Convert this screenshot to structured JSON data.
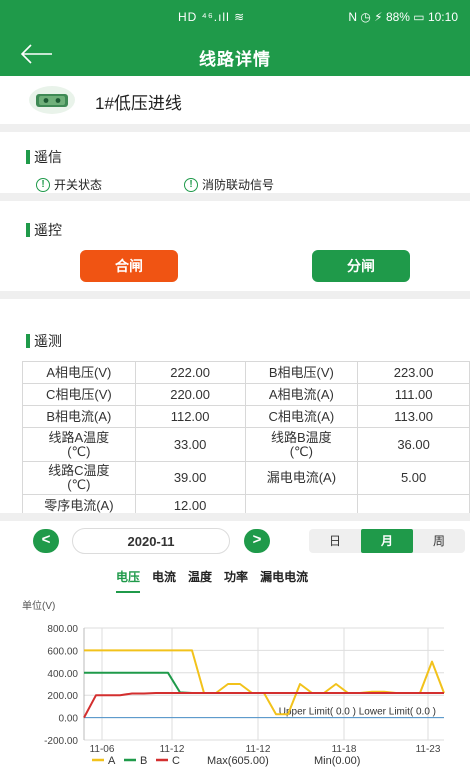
{
  "status": {
    "signal": "HD ⁴⁶.ıll ≋",
    "right": "N ◷ ⚡ 88% ▭ 10:10"
  },
  "appbar": {
    "title": "线路详情"
  },
  "device": {
    "name": "1#低压进线"
  },
  "remote_signal": {
    "title": "遥信",
    "items": [
      "开关状态",
      "消防联动信号"
    ]
  },
  "remote_control": {
    "title": "遥控",
    "close_label": "合闸",
    "open_label": "分闸"
  },
  "telemetry": {
    "title": "遥测",
    "rows": [
      [
        "A相电压(V)",
        "222.00",
        "B相电压(V)",
        "223.00"
      ],
      [
        "C相电压(V)",
        "220.00",
        "A相电流(A)",
        "111.00"
      ],
      [
        "B相电流(A)",
        "112.00",
        "C相电流(A)",
        "113.00"
      ],
      [
        "线路A温度\n(℃)",
        "33.00",
        "线路B温度\n(℃)",
        "36.00"
      ],
      [
        "线路C温度\n(℃)",
        "39.00",
        "漏电电流(A)",
        "5.00"
      ],
      [
        "零序电流(A)",
        "12.00",
        "",
        ""
      ]
    ]
  },
  "date": {
    "value": "2020-11",
    "prev": "<",
    "next": ">"
  },
  "period": {
    "options": [
      "日",
      "月",
      "周"
    ],
    "selected": "月"
  },
  "chart_tabs": {
    "items": [
      "电压",
      "电流",
      "温度",
      "功率",
      "漏电电流"
    ],
    "selected": "电压"
  },
  "chart_data": {
    "type": "line",
    "unit_label": "单位(V)",
    "x_ticks": [
      "11-06",
      "11-12",
      "11-12",
      "11-18",
      "11-23"
    ],
    "y_ticks": [
      "800.00",
      "600.00",
      "400.00",
      "200.00",
      "0.00",
      "-200.00"
    ],
    "ylim": [
      -200,
      800
    ],
    "n_points": 31,
    "grid": true,
    "series": [
      {
        "name": "A",
        "color": "#f2c21b",
        "values": [
          600,
          600,
          600,
          600,
          600,
          600,
          600,
          600,
          600,
          600,
          220,
          220,
          300,
          300,
          220,
          220,
          30,
          30,
          300,
          220,
          220,
          300,
          220,
          220,
          230,
          230,
          220,
          220,
          220,
          500,
          220
        ]
      },
      {
        "name": "B",
        "color": "#1f9a4a",
        "values": [
          400,
          400,
          400,
          400,
          400,
          400,
          400,
          400,
          225,
          220,
          220,
          220,
          220,
          220,
          220,
          220,
          220,
          220,
          220,
          220,
          220,
          220,
          220,
          220,
          220,
          220,
          220,
          220,
          220,
          220,
          220
        ]
      },
      {
        "name": "C",
        "color": "#d32f2f",
        "values": [
          0,
          200,
          200,
          200,
          215,
          215,
          220,
          220,
          220,
          220,
          220,
          220,
          220,
          220,
          220,
          220,
          220,
          220,
          220,
          220,
          220,
          220,
          220,
          220,
          220,
          220,
          220,
          220,
          220,
          220,
          220
        ]
      }
    ],
    "limits_label": "Upper Limit( 0.0 ) Lower Limit( 0.0 )",
    "legend": {
      "max": "Max(605.00)",
      "min": "Min(0.00)"
    }
  }
}
